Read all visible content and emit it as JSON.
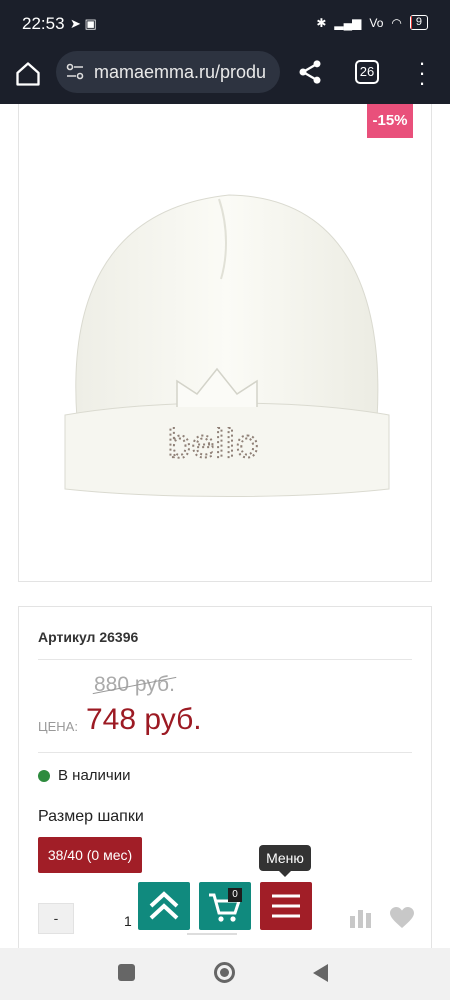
{
  "status_bar": {
    "time": "22:53",
    "left_icons": "➤ ▣",
    "battery": "9",
    "battery_level_percent": 9
  },
  "browser": {
    "url": "mamaemma.ru/produ",
    "tab_count": "26"
  },
  "product": {
    "discount_badge": "-15%",
    "image_text": "bello"
  },
  "info": {
    "sku": "Артикул 26396",
    "old_price": "880 руб.",
    "price_label": "ЦЕНА:",
    "price": "748 руб.",
    "stock": "В наличии",
    "stock_color": "#2e8b3e",
    "size_label": "Размер шапки",
    "size_option": "38/40 (0 мес)",
    "qty_minus": "-",
    "qty_value": "1"
  },
  "floating": {
    "cart_count": "0",
    "tooltip": "Меню",
    "icons": [
      "chevron-double-up-icon",
      "cart-icon",
      "menu-icon"
    ]
  },
  "colors": {
    "accent_red": "#a11e27",
    "accent_teal": "#108a7e",
    "badge_pink": "#e9507b",
    "price_red": "#9c1a23"
  }
}
